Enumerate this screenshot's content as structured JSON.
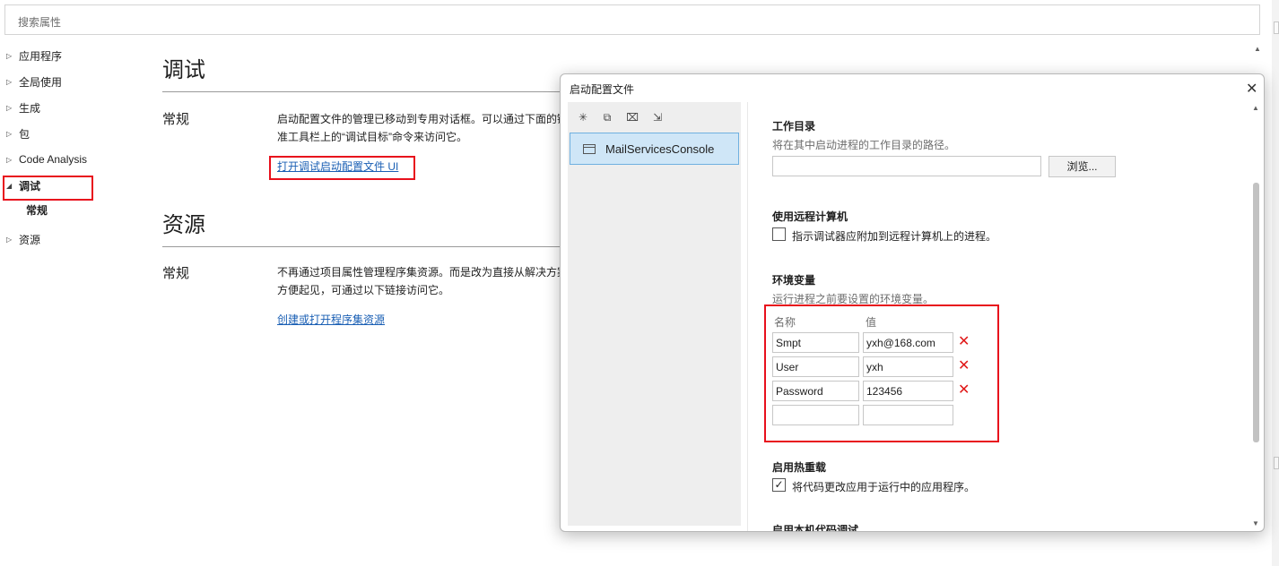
{
  "search": {
    "placeholder": "搜索属性"
  },
  "tree": {
    "items": [
      {
        "label": "应用程序"
      },
      {
        "label": "全局使用"
      },
      {
        "label": "生成"
      },
      {
        "label": "包"
      },
      {
        "label": "Code Analysis"
      },
      {
        "label": "调试"
      },
      {
        "label": "资源"
      }
    ],
    "debug_sub": "常规",
    "expanded_arrow": "◢",
    "collapsed_arrow": "▷"
  },
  "main": {
    "debug_title": "调试",
    "debug_general": "常规",
    "debug_desc_line1": "启动配置文件的管理已移动到专用对话框。可以通过下面的链接",
    "debug_desc_line2": "准工具栏上的“调试目标”命令来访问它。",
    "debug_link": "打开调试启动配置文件 UI",
    "res_title": "资源",
    "res_general": "常规",
    "res_desc_line1": "不再通过项目属性管理程序集资源。而是改为直接从解决方案资源管理器",
    "res_desc_line2": "方便起见，可通过以下链接访问它。",
    "res_link": "创建或打开程序集资源"
  },
  "dialog": {
    "title": "启动配置文件",
    "close_glyph": "✕",
    "profile_name": "MailServicesConsole",
    "workdir": {
      "title": "工作目录",
      "desc": "将在其中启动进程的工作目录的路径。",
      "value": "",
      "browse_label": "浏览..."
    },
    "remote": {
      "title": "使用远程计算机",
      "check_label": "指示调试器应附加到远程计算机上的进程。"
    },
    "env": {
      "title": "环境变量",
      "desc": "运行进程之前要设置的环境变量。",
      "col_name": "名称",
      "col_value": "值",
      "rows": [
        {
          "name": "Smpt",
          "value": "yxh@168.com"
        },
        {
          "name": "User",
          "value": "yxh"
        },
        {
          "name": "Password",
          "value": "123456"
        }
      ],
      "new_name": "",
      "new_value": "",
      "delete_glyph": "✕"
    },
    "hotreload": {
      "title": "启用热重载",
      "check_label": "将代码更改应用于运行中的应用程序。",
      "check_glyph": "✓"
    },
    "native": {
      "title": "启用本机代码调试"
    }
  },
  "colors": {
    "highlight_red": "#e8101c",
    "link_blue": "#1a5fb4",
    "selected_bg": "#cfe6f7"
  }
}
